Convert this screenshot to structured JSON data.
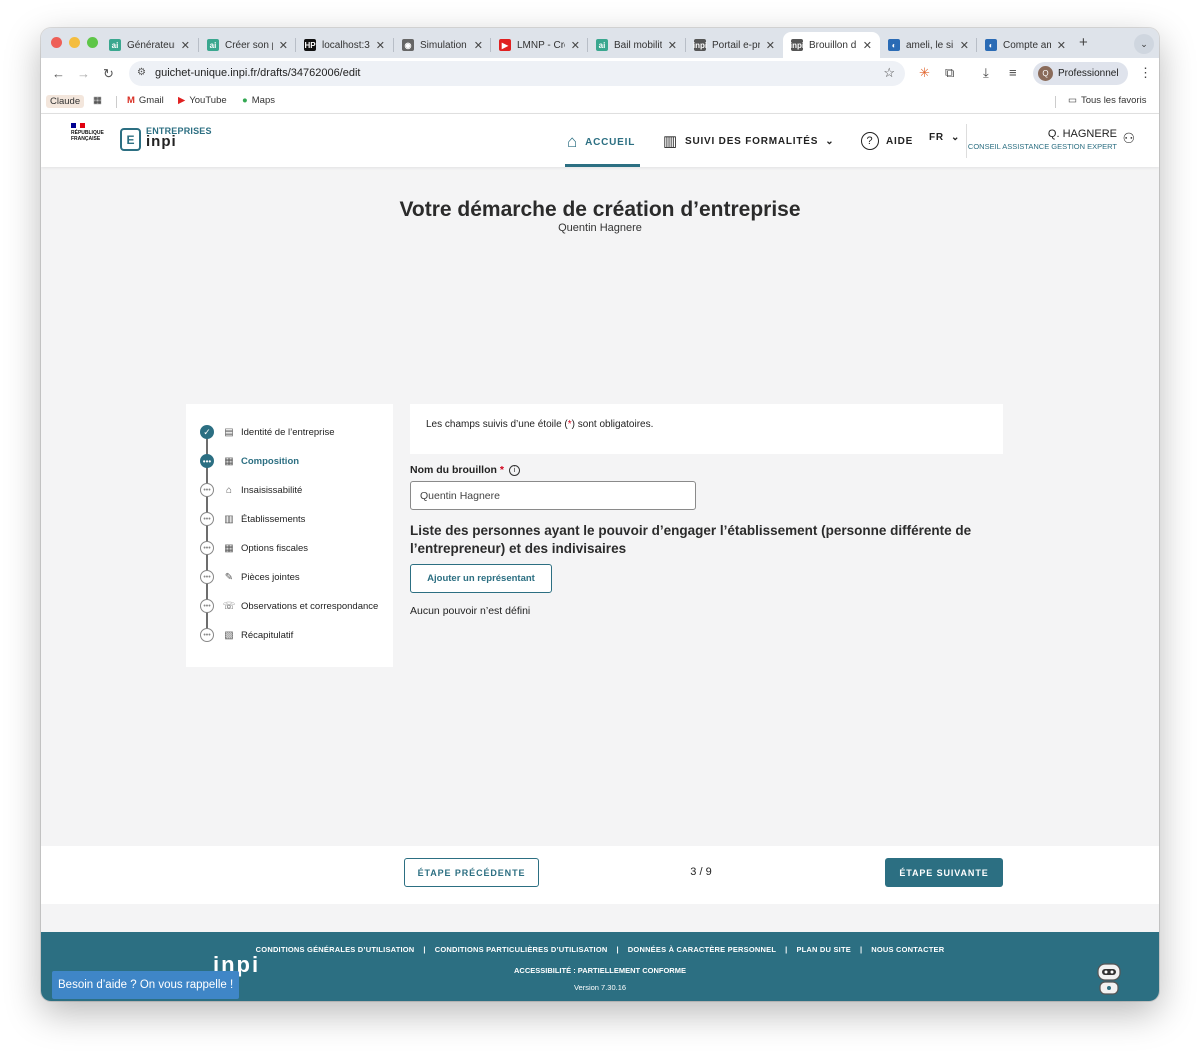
{
  "browser": {
    "tabs": [
      {
        "title": "Générateur",
        "fav": "ai",
        "favColor": "#3aa78f"
      },
      {
        "title": "Créer son p",
        "fav": "ai",
        "favColor": "#3aa78f"
      },
      {
        "title": "localhost:3",
        "fav": "HP",
        "favColor": "#111111"
      },
      {
        "title": "Simulation",
        "fav": "◉",
        "favColor": "#666666"
      },
      {
        "title": "LMNP - Cré",
        "fav": "▶",
        "favColor": "#e02020"
      },
      {
        "title": "Bail mobilit",
        "fav": "ai",
        "favColor": "#3aa78f"
      },
      {
        "title": "Portail e-pr",
        "fav": "inpi",
        "favColor": "#555555"
      },
      {
        "title": "Brouillon d",
        "fav": "inpi",
        "favColor": "#555555"
      },
      {
        "title": "ameli, le si",
        "fav": "◐",
        "favColor": "#2a6bb5"
      },
      {
        "title": "Compte am",
        "fav": "◐",
        "favColor": "#2a6bb5"
      }
    ],
    "url": "guichet-unique.inpi.fr/drafts/34762006/edit",
    "profile": "Professionnel",
    "profile_initial": "Q",
    "bookmarks": {
      "claude": "Claude",
      "gmail": "Gmail",
      "youtube": "YouTube",
      "maps": "Maps",
      "all": "Tous les favoris"
    }
  },
  "header": {
    "rf_line1": "RÉPUBLIQUE",
    "rf_line2": "FRANÇAISE",
    "logo_line1": "ENTREPRISES",
    "logo_line2": "inpi",
    "nav_home": "ACCUEIL",
    "nav_tracking": "SUIVI DES FORMALITÉS",
    "nav_help": "AIDE",
    "lang": "FR",
    "user_name": "Q. HAGNERE",
    "user_role": "CONSEIL ASSISTANCE GESTION EXPERT"
  },
  "page": {
    "title": "Votre démarche de création d’entreprise",
    "subtitle": "Quentin Hagnere"
  },
  "steps": [
    {
      "label": "Identité de l’entreprise",
      "state": "done",
      "icon": "▤"
    },
    {
      "label": "Composition",
      "state": "current",
      "icon": "▦"
    },
    {
      "label": "Insaisissabilité",
      "state": "todo",
      "icon": "⌂"
    },
    {
      "label": "Établissements",
      "state": "todo",
      "icon": "▥"
    },
    {
      "label": "Options fiscales",
      "state": "todo",
      "icon": "▦"
    },
    {
      "label": "Pièces jointes",
      "state": "todo",
      "icon": "✎"
    },
    {
      "label": "Observations et correspondance",
      "state": "todo",
      "icon": "☏"
    },
    {
      "label": "Récapitulatif",
      "state": "todo",
      "icon": "▧"
    }
  ],
  "form": {
    "notice_before": "Les champs suivis d’une étoile (",
    "notice_star": "*",
    "notice_after": ") sont obligatoires.",
    "draft_label": "Nom du brouillon",
    "draft_value": "Quentin Hagnere",
    "persons_title": "Liste des personnes ayant le pouvoir d’engager l’établissement (personne différente de l’entrepreneur) et des indivisaires",
    "add_button": "Ajouter un représentant",
    "no_power": "Aucun pouvoir n’est défini"
  },
  "pager": {
    "prev": "ÉTAPE PRÉCÉDENTE",
    "counter": "3 / 9",
    "next": "ÉTAPE SUIVANTE"
  },
  "footer": {
    "logo": "inpi",
    "links": [
      "CONDITIONS GÉNÉRALES D’UTILISATION",
      "CONDITIONS PARTICULIÈRES D’UTILISATION",
      "DONNÉES À CARACTÈRE PERSONNEL",
      "PLAN DU SITE",
      "NOUS CONTACTER"
    ],
    "accessibility": "ACCESSIBILITÉ : PARTIELLEMENT CONFORME",
    "version": "Version 7.30.16",
    "callback": "Besoin d’aide ? On vous rappelle !"
  },
  "colors": {
    "brand": "#2c6f82",
    "callback": "#3f86c7",
    "required": "#d0021b"
  }
}
